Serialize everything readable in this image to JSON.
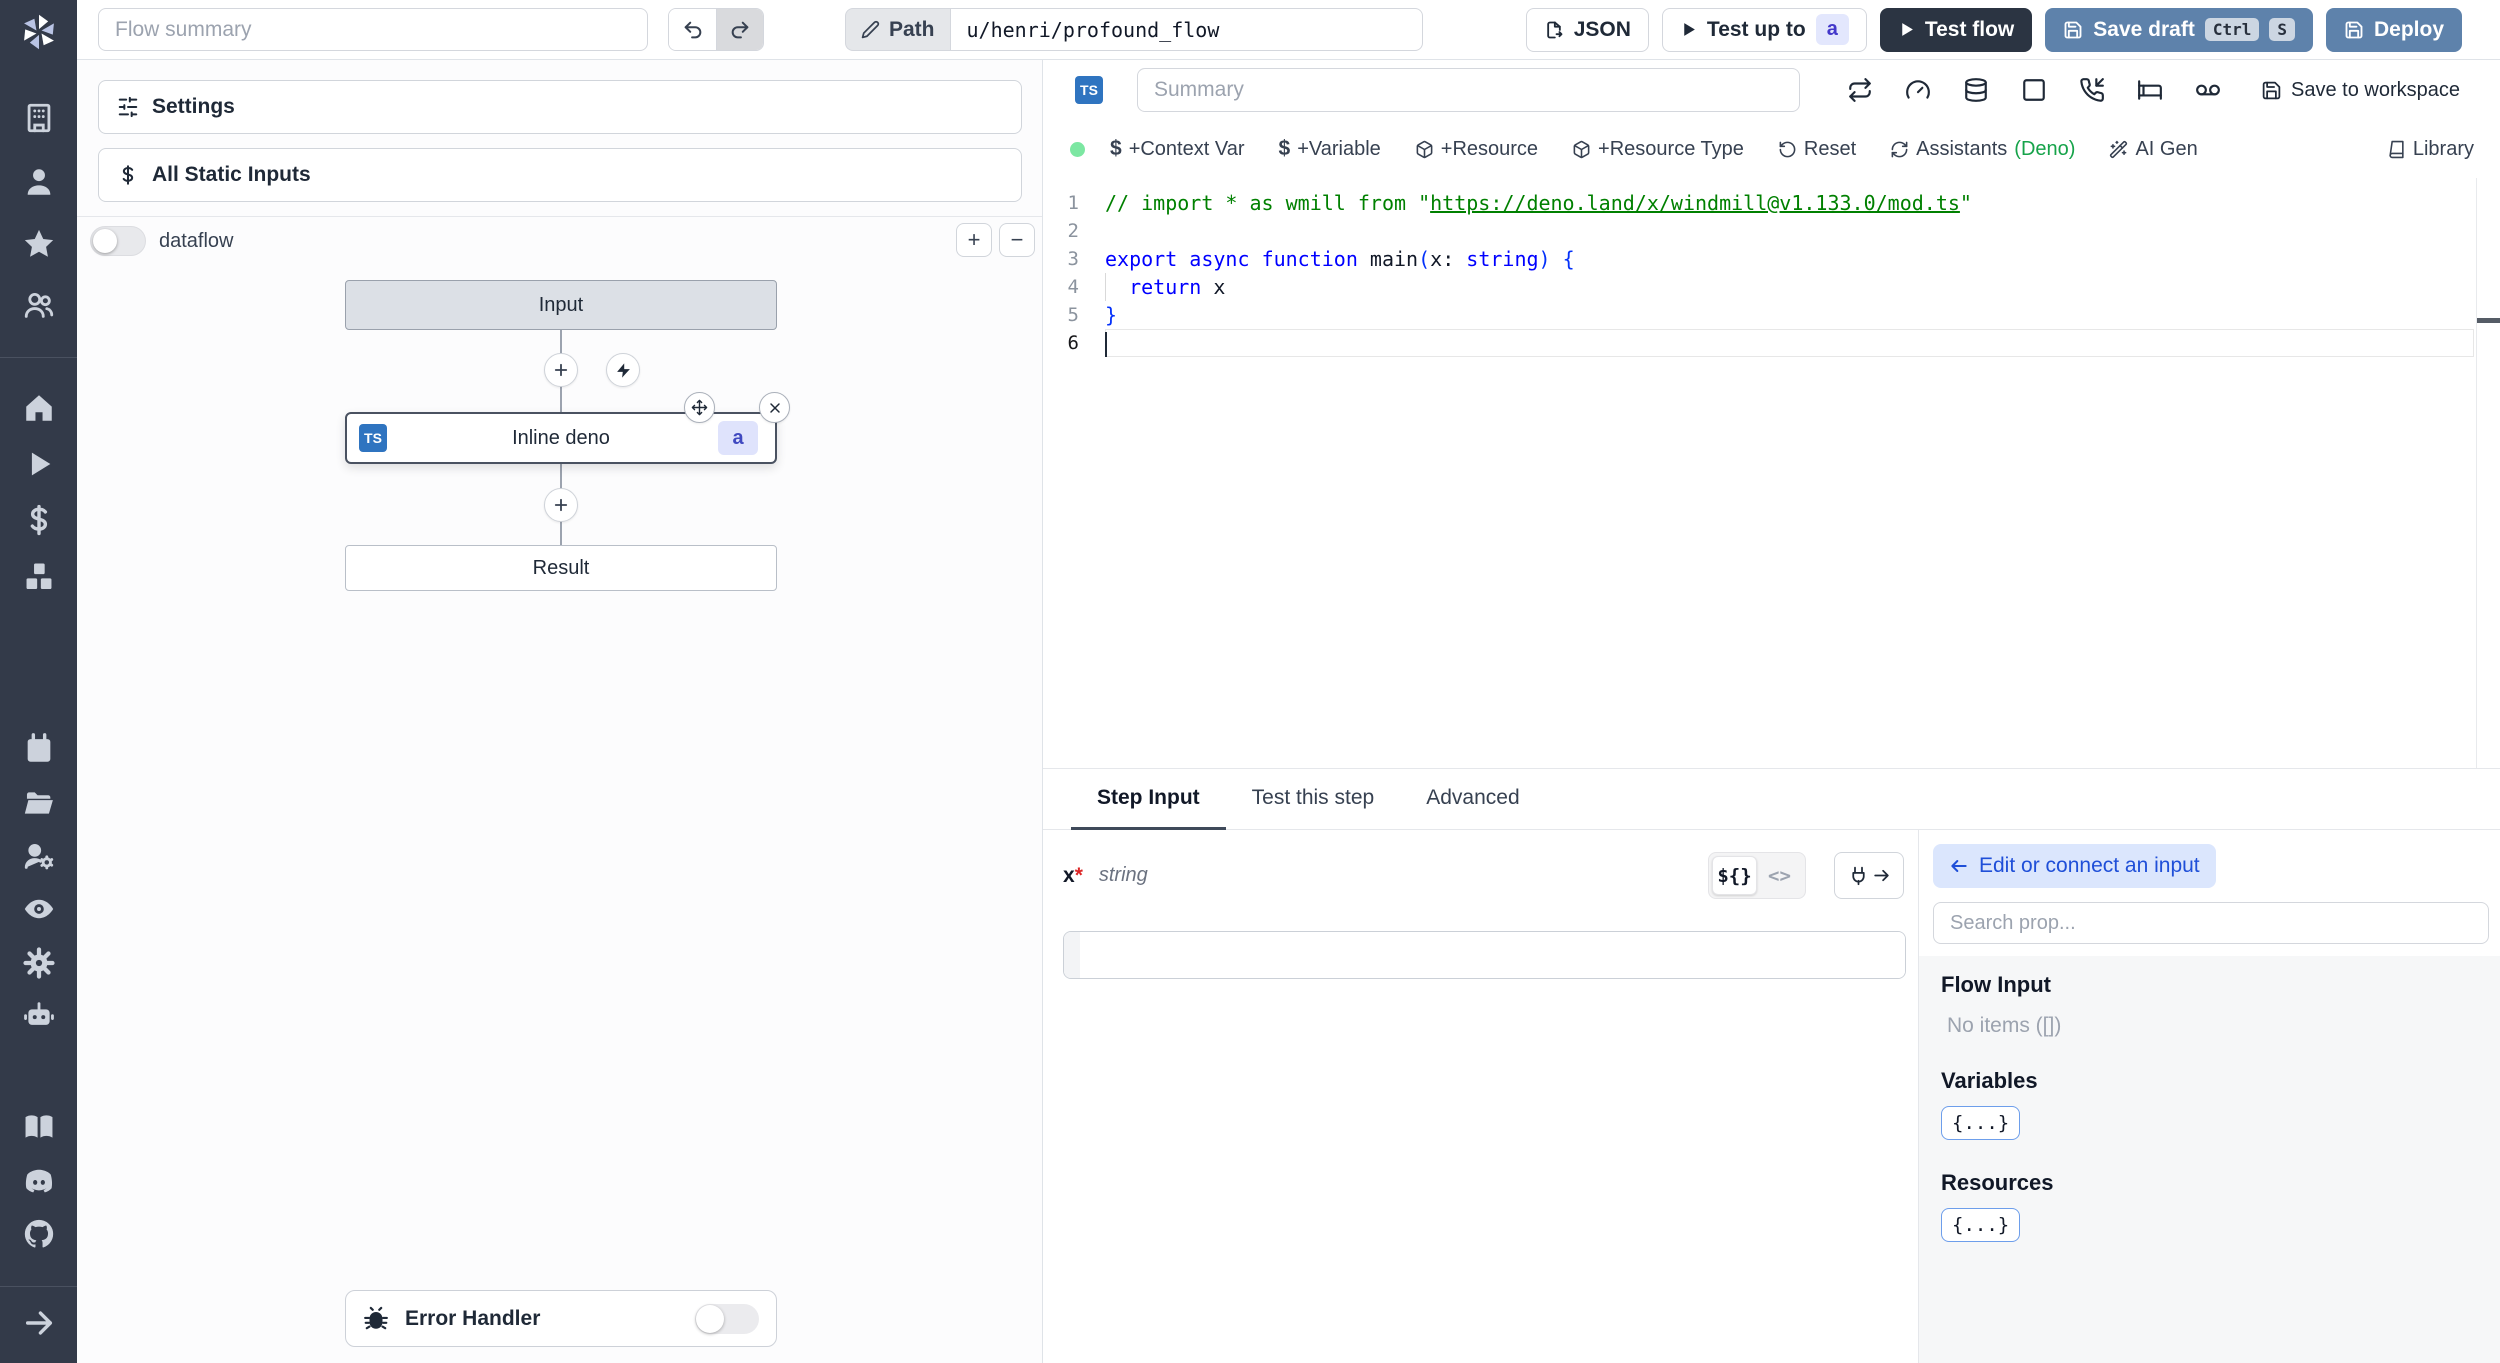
{
  "topbar": {
    "flow_summary_placeholder": "Flow summary",
    "path_label": "Path",
    "path_value": "u/henri/profound_flow",
    "json_label": "JSON",
    "test_up_to_label": "Test up to",
    "test_up_to_badge": "a",
    "test_flow_label": "Test flow",
    "save_draft_label": "Save draft",
    "kbd_ctrl": "Ctrl",
    "kbd_s": "S",
    "deploy_label": "Deploy"
  },
  "sidebar": {
    "icons": [
      "windmill-logo",
      "building",
      "user",
      "star",
      "users",
      "home",
      "play",
      "dollar",
      "boxes",
      "calendar",
      "folder-open",
      "user-cog",
      "eye",
      "settings-gear",
      "bot",
      "book-open",
      "discord",
      "github",
      "arrow-right"
    ]
  },
  "flow_panel": {
    "settings_label": "Settings",
    "all_static_inputs_label": "All Static Inputs",
    "dataflow_label": "dataflow",
    "zoom_in": "+",
    "zoom_out": "−",
    "graph": {
      "input_node": "Input",
      "step_node": "Inline deno",
      "step_lang_badge": "TS",
      "step_id_badge": "a",
      "result_node": "Result"
    },
    "error_handler_label": "Error Handler"
  },
  "editor": {
    "lang_badge": "TS",
    "summary_placeholder": "Summary",
    "save_to_workspace_label": "Save to workspace",
    "status_color": "#7ce7a2",
    "toolbar": {
      "context_var": "+Context Var",
      "variable": "+Variable",
      "resource": "+Resource",
      "resource_type": "+Resource Type",
      "reset": "Reset",
      "assistants": "Assistants",
      "assistants_lang": "(Deno)",
      "ai_gen": "AI Gen",
      "library": "Library"
    },
    "code": {
      "lines": [
        {
          "n": 1,
          "tokens": [
            {
              "t": "// import * as wmill from \"",
              "c": "comment"
            },
            {
              "t": "https://deno.land/x/windmill@v1.133.0/mod.ts",
              "c": "comment-link"
            },
            {
              "t": "\"",
              "c": "comment"
            }
          ]
        },
        {
          "n": 2,
          "tokens": []
        },
        {
          "n": 3,
          "tokens": [
            {
              "t": "export",
              "c": "kw"
            },
            {
              "t": " ",
              "c": "plain"
            },
            {
              "t": "async",
              "c": "kw"
            },
            {
              "t": " ",
              "c": "plain"
            },
            {
              "t": "function",
              "c": "kw"
            },
            {
              "t": " main",
              "c": "plain"
            },
            {
              "t": "(",
              "c": "bracket"
            },
            {
              "t": "x: ",
              "c": "plain"
            },
            {
              "t": "string",
              "c": "kw"
            },
            {
              "t": ")",
              "c": "bracket"
            },
            {
              "t": " {",
              "c": "bracket"
            }
          ]
        },
        {
          "n": 4,
          "guide": true,
          "tokens": [
            {
              "t": "  ",
              "c": "plain"
            },
            {
              "t": "return",
              "c": "kw"
            },
            {
              "t": " x",
              "c": "plain"
            }
          ]
        },
        {
          "n": 5,
          "tokens": [
            {
              "t": "}",
              "c": "bracket"
            }
          ]
        },
        {
          "n": 6,
          "tokens": [],
          "cursor": true,
          "active": true
        }
      ]
    }
  },
  "step_panel": {
    "tabs": [
      "Step Input",
      "Test this step",
      "Advanced"
    ],
    "field_name": "x",
    "field_required_mark": "*",
    "field_type": "string",
    "field_value": "",
    "mode_expr": "${}",
    "mode_code": "<>"
  },
  "prop_picker": {
    "edit_connect_label": "Edit or connect an input",
    "search_placeholder": "Search prop...",
    "flow_input_title": "Flow Input",
    "flow_input_empty": "No items ([])",
    "variables_title": "Variables",
    "variables_chip": "{...}",
    "resources_title": "Resources",
    "resources_chip": "{...}"
  }
}
